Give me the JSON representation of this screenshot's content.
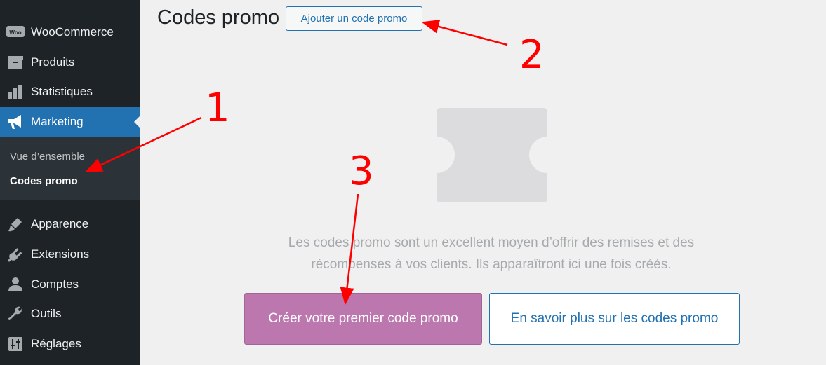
{
  "sidebar": {
    "items": [
      {
        "label": "WooCommerce",
        "icon": "woocommerce-icon"
      },
      {
        "label": "Produits",
        "icon": "archive-icon"
      },
      {
        "label": "Statistiques",
        "icon": "bar-chart-icon"
      },
      {
        "label": "Marketing",
        "icon": "megaphone-icon",
        "active": true
      },
      {
        "label": "Apparence",
        "icon": "paintbrush-icon"
      },
      {
        "label": "Extensions",
        "icon": "plug-icon"
      },
      {
        "label": "Comptes",
        "icon": "user-icon"
      },
      {
        "label": "Outils",
        "icon": "wrench-icon"
      },
      {
        "label": "Réglages",
        "icon": "settings-sliders-icon"
      }
    ],
    "submenu": [
      {
        "label": "Vue d’ensemble"
      },
      {
        "label": "Codes promo",
        "current": true
      }
    ],
    "woo_badge": "Woo"
  },
  "header": {
    "title": "Codes promo",
    "add_button": "Ajouter un code promo"
  },
  "empty_state": {
    "line1": "Les codes promo sont un excellent moyen d’offrir des remises et des",
    "line2": "récompenses à vos clients. Ils apparaîtront ici une fois créés.",
    "primary_button": "Créer votre premier code promo",
    "secondary_button": "En savoir plus sur les codes promo"
  },
  "annotations": {
    "n1": "1",
    "n2": "2",
    "n3": "3"
  },
  "colors": {
    "sidebar_bg": "#1d2327",
    "active": "#2271b1",
    "primary_button": "#bb77ae",
    "annotation": "#ff0000"
  }
}
